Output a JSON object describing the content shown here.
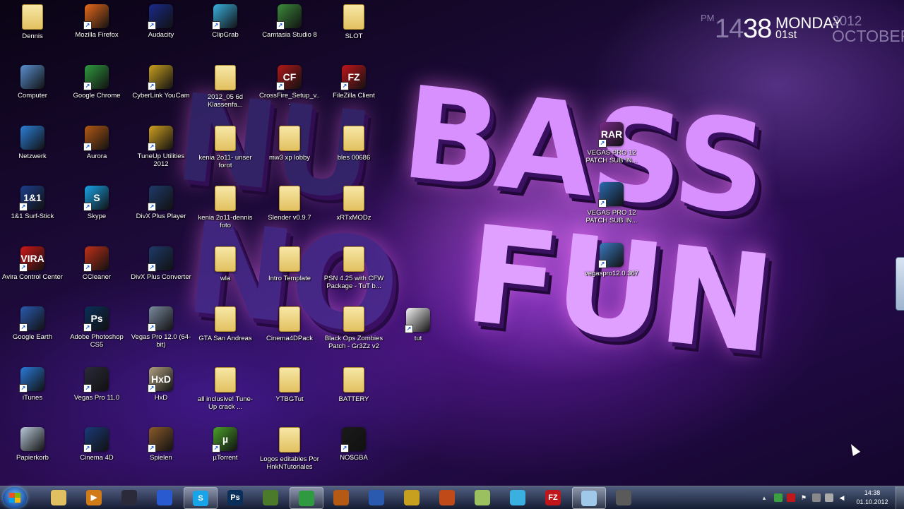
{
  "wallpaper": {
    "line1a": "NU",
    "line1b": "BASS",
    "line2a": "NO",
    "line2b": "FUN"
  },
  "clock_gadget": {
    "ampm": "PM",
    "hour": "14",
    "minute": "38",
    "weekday": "MONDAY",
    "date": "01st",
    "year": "2012",
    "month": "OCTOBER"
  },
  "desktop_icons": [
    {
      "label": "Dennis",
      "glyph": "",
      "color": "folder"
    },
    {
      "label": "Mozilla Firefox",
      "glyph": "",
      "color": "#e86a1c"
    },
    {
      "label": "Audacity",
      "glyph": "",
      "color": "#1a2a8a"
    },
    {
      "label": "ClipGrab",
      "glyph": "",
      "color": "#3ab0e0"
    },
    {
      "label": "Camtasia Studio 8",
      "glyph": "",
      "color": "#3c8a3c"
    },
    {
      "label": "SLOT",
      "glyph": "",
      "color": "folder"
    },
    {
      "label": "Computer",
      "glyph": "",
      "color": "#5a8fd0"
    },
    {
      "label": "Google Chrome",
      "glyph": "",
      "color": "#2f9a3f"
    },
    {
      "label": "CyberLink YouCam",
      "glyph": "",
      "color": "#c8a020"
    },
    {
      "label": "2012_05 6d Klassenfa...",
      "glyph": "",
      "color": "folder"
    },
    {
      "label": "CrossFire_Setup_v...",
      "glyph": "CF",
      "color": "#b01818"
    },
    {
      "label": "FileZilla Client",
      "glyph": "FZ",
      "color": "#c0161b"
    },
    {
      "label": "Netzwerk",
      "glyph": "",
      "color": "#2b7fd8"
    },
    {
      "label": "Aurora",
      "glyph": "",
      "color": "#b45a14"
    },
    {
      "label": "TuneUp Utilities 2012",
      "glyph": "",
      "color": "#d0a020"
    },
    {
      "label": "kenia 2o11- unser forot",
      "glyph": "",
      "color": "folder"
    },
    {
      "label": "mw3 xp lobby",
      "glyph": "",
      "color": "folder"
    },
    {
      "label": "bles 00686",
      "glyph": "",
      "color": "folder"
    },
    {
      "label": "VEGAS PRO 12 PATCH SUB IN...",
      "glyph": "RAR",
      "color": "#7a2a8a"
    },
    {
      "label": "1&1 Surf-Stick",
      "glyph": "1&1",
      "color": "#1d3e8c"
    },
    {
      "label": "Skype",
      "glyph": "S",
      "color": "#18a4e8"
    },
    {
      "label": "DivX Plus Player",
      "glyph": "",
      "color": "#1e3a6a"
    },
    {
      "label": "kenia 2o11-dennis foto",
      "glyph": "",
      "color": "folder"
    },
    {
      "label": "Slender v0.9.7",
      "glyph": "",
      "color": "folder"
    },
    {
      "label": "xRTxMODz",
      "glyph": "",
      "color": "folder"
    },
    {
      "label": "VEGAS PRO 12 PATCH SUB IN...",
      "glyph": "",
      "color": "#2a6ab0"
    },
    {
      "label": "Avira Control Center",
      "glyph": "VIRA",
      "color": "#d01818"
    },
    {
      "label": "CCleaner",
      "glyph": "",
      "color": "#c03018"
    },
    {
      "label": "DivX Plus Converter",
      "glyph": "",
      "color": "#1e3a6a"
    },
    {
      "label": "wla",
      "glyph": "",
      "color": "folder"
    },
    {
      "label": "Intro Template",
      "glyph": "",
      "color": "folder"
    },
    {
      "label": "PSN 4.25 with CFW Package - TuT b...",
      "glyph": "",
      "color": "folder"
    },
    {
      "label": "vegaspro12.0.367",
      "glyph": "",
      "color": "#3a7ac0"
    },
    {
      "label": "Google Earth",
      "glyph": "",
      "color": "#2a5ab0"
    },
    {
      "label": "Adobe Photoshop CS5",
      "glyph": "Ps",
      "color": "#0a2f5a"
    },
    {
      "label": "Vegas Pro 12.0 (64-bit)",
      "glyph": "",
      "color": "#7a8aa0"
    },
    {
      "label": "GTA San Andreas",
      "glyph": "",
      "color": "folder"
    },
    {
      "label": "Cinema4DPack",
      "glyph": "",
      "color": "folder"
    },
    {
      "label": "Black Ops Zombies Patch - Gr3Zz v2",
      "glyph": "",
      "color": "folder"
    },
    {
      "label": "tut",
      "glyph": "",
      "color": "#f2f2f2"
    },
    {
      "label": "iTunes",
      "glyph": "",
      "color": "#2a7ad8"
    },
    {
      "label": "Vegas Pro 11.0",
      "glyph": "",
      "color": "#2a2a3a"
    },
    {
      "label": "HxD",
      "glyph": "HxD",
      "color": "#b0a080"
    },
    {
      "label": "all inclusive! Tune-Up crack ...",
      "glyph": "",
      "color": "folder"
    },
    {
      "label": "YTBGTut",
      "glyph": "",
      "color": "folder"
    },
    {
      "label": "BATTERY",
      "glyph": "",
      "color": "folder"
    },
    {
      "label": "Papierkorb",
      "glyph": "",
      "color": "#b8c8d8"
    },
    {
      "label": "Cinema 4D",
      "glyph": "",
      "color": "#1a3a7a"
    },
    {
      "label": "Spielen",
      "glyph": "",
      "color": "#8a5a2a"
    },
    {
      "label": "µTorrent",
      "glyph": "µ",
      "color": "#4aa02a"
    },
    {
      "label": "Logos editables Por HnkNTutoriales",
      "glyph": "",
      "color": "folder"
    },
    {
      "label": "NO$GBA",
      "glyph": "",
      "color": "#1a1a1a"
    }
  ],
  "taskbar": {
    "items": [
      {
        "name": "explorer",
        "glyph": "",
        "color": "#e0c060"
      },
      {
        "name": "media-player",
        "glyph": "▶",
        "color": "#d07a18"
      },
      {
        "name": "vegas-pro",
        "glyph": "",
        "color": "#2a2a3a"
      },
      {
        "name": "firefox",
        "glyph": "",
        "color": "#2a5ad0"
      },
      {
        "name": "skype",
        "glyph": "S",
        "color": "#18a4e8"
      },
      {
        "name": "photoshop",
        "glyph": "Ps",
        "color": "#0a2f5a"
      },
      {
        "name": "minecraft",
        "glyph": "",
        "color": "#4a7a2a"
      },
      {
        "name": "chrome",
        "glyph": "",
        "color": "#2f9a3f"
      },
      {
        "name": "aurora",
        "glyph": "",
        "color": "#b45a14"
      },
      {
        "name": "google-earth",
        "glyph": "",
        "color": "#2a5ab0"
      },
      {
        "name": "youcam",
        "glyph": "",
        "color": "#c8a020"
      },
      {
        "name": "audacity",
        "glyph": "",
        "color": "#c04a18"
      },
      {
        "name": "notes",
        "glyph": "",
        "color": "#9ac060"
      },
      {
        "name": "clipgrab",
        "glyph": "",
        "color": "#3ab0e0"
      },
      {
        "name": "filezilla",
        "glyph": "FZ",
        "color": "#c0161b"
      },
      {
        "name": "window",
        "glyph": "",
        "color": "#a0c8e8"
      },
      {
        "name": "camtasia",
        "glyph": "",
        "color": "#5a5a5a"
      }
    ],
    "time": "14:38",
    "date": "01.10.2012"
  }
}
